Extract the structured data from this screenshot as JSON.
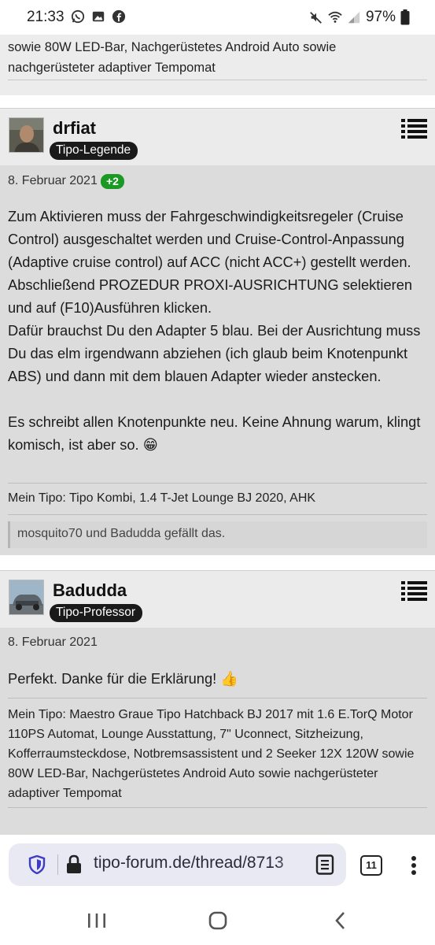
{
  "status_bar": {
    "time": "21:33",
    "battery": "97%",
    "icons_left": [
      "whatsapp-icon",
      "gallery-icon",
      "facebook-icon"
    ],
    "icons_right": [
      "mute-icon",
      "wifi-icon",
      "signal-icon",
      "battery-icon"
    ]
  },
  "previous_post": {
    "signature": "sowie 80W LED-Bar, Nachgerüstetes Android Auto sowie nachgerüsteter adaptiver Tempomat"
  },
  "posts": [
    {
      "username": "drfiat",
      "rank": "Tipo-Legende",
      "date": "8. Februar 2021",
      "likes_badge": "+2",
      "paragraphs": [
        "Zum Aktivieren muss der Fahrgeschwindigkeitsregeler (Cruise Control) ausgeschaltet werden und Cruise-Control-Anpassung (Adaptive cruise control) auf ACC (nicht ACC+) gestellt werden. Abschließend PROZEDUR PROXI-AUSRICHTUNG selektieren und auf (F10)Ausführen klicken.",
        "Dafür brauchst Du den Adapter 5 blau. Bei der Ausrichtung muss Du das elm irgendwann abziehen (ich glaub beim Knotenpunkt ABS) und dann mit dem blauen Adapter wieder anstecken.",
        "Es schreibt allen Knotenpunkte neu. Keine Ahnung warum, klingt komisch, ist aber so. 😁"
      ],
      "signature": "Mein Tipo: Tipo Kombi, 1.4 T-Jet Lounge BJ 2020, AHK",
      "liked_by": "mosquito70 und Badudda gefällt das."
    },
    {
      "username": "Badudda",
      "rank": "Tipo-Professor",
      "date": "8. Februar 2021",
      "text": "Perfekt. Danke für die Erklärung! 👍",
      "signature": "Mein Tipo: Maestro Graue Tipo Hatchback BJ 2017 mit 1.6 E.TorQ Motor 110PS Automat, Lounge Ausstattung, 7\" Uconnect, Sitzheizung, Kofferraumsteckdose, Notbremsassistent und 2 Seeker 12X 120W sowie 80W LED-Bar, Nachgerüstetes Android Auto sowie nachgerüsteter adaptiver Tempomat"
    }
  ],
  "browser": {
    "url": "tipo-forum.de/thread/8713",
    "tab_count": "11"
  },
  "colors": {
    "post_header_bg": "#ebebeb",
    "post_body_bg": "#dcdcdc",
    "badge_bg": "#1a1a1a",
    "like_badge_bg": "#1a9a22",
    "url_bar_bg": "#e9e9f3"
  }
}
